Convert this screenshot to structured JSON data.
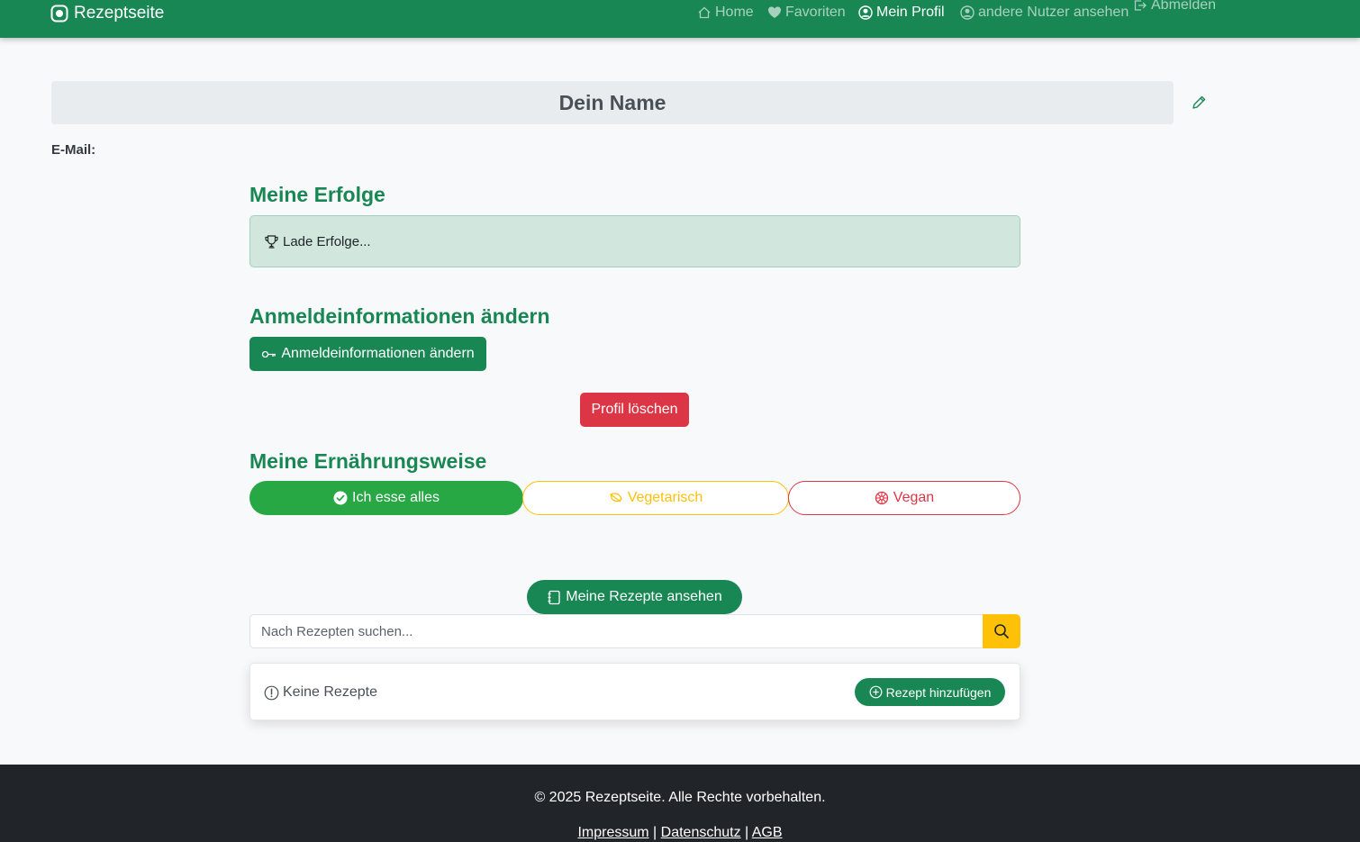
{
  "navbar": {
    "brand": "Rezeptseite",
    "items": [
      {
        "label": "Home",
        "icon": "house-icon"
      },
      {
        "label": "Favoriten",
        "icon": "heart-icon"
      },
      {
        "label": "Mein Profil",
        "icon": "person-circle-icon",
        "active": true
      },
      {
        "label": "andere Nutzer ansehen",
        "icon": "person-circle-icon"
      },
      {
        "label": "Abmelden",
        "icon": "box-arrow-right-icon"
      }
    ]
  },
  "profile": {
    "name": "Dein Name",
    "email_label": "E-Mail:"
  },
  "achievements": {
    "title": "Meine Erfolge",
    "loading_text": "Lade Erfolge..."
  },
  "credentials": {
    "title": "Anmeldeinformationen ändern",
    "button_label": "Anmeldeinformationen ändern"
  },
  "delete_profile_label": "Profil löschen",
  "diet": {
    "title": "Meine Ernährungsweise",
    "options": [
      {
        "label": "Ich esse alles",
        "selected": true
      },
      {
        "label": "Vegetarisch",
        "selected": false
      },
      {
        "label": "Vegan",
        "selected": false
      }
    ]
  },
  "recipes": {
    "view_button": "Meine Rezepte ansehen",
    "search_placeholder": "Nach Rezepten suchen...",
    "empty_text": "Keine Rezepte",
    "add_button": "Rezept hinzufügen"
  },
  "footer": {
    "copyright": "© 2025 Rezeptseite. Alle Rechte vorbehalten.",
    "links": [
      "Impressum",
      "Datenschutz",
      "AGB"
    ],
    "separator": "|"
  },
  "colors": {
    "primary": "#198754",
    "success": "#28a745",
    "warning": "#ffc107",
    "danger": "#dc3545",
    "footer_bg": "#212529"
  }
}
